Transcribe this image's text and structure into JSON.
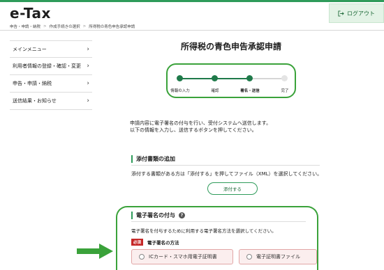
{
  "header": {
    "logo": "e-Tax",
    "logout_label": "ログアウト"
  },
  "breadcrumb": [
    "申告・申請・納税",
    "作成手続きの選択",
    "所得税の青色申告承認申請"
  ],
  "sidebar": {
    "items": [
      {
        "label": "メインメニュー"
      },
      {
        "label": "利用者情報の登録・確認・変更"
      },
      {
        "label": "申告・申請・納税"
      },
      {
        "label": "送信結果・お知らせ"
      }
    ]
  },
  "main": {
    "title": "所得税の青色申告承認申請",
    "steps": [
      {
        "label": "情報の入力",
        "state": "done"
      },
      {
        "label": "確認",
        "state": "done"
      },
      {
        "label": "署名・送信",
        "state": "current"
      },
      {
        "label": "完了",
        "state": "todo"
      }
    ],
    "intro_line1": "申請内容に電子署名の付与を行い、受付システムへ送信します。",
    "intro_line2": "以下の情報を入力し、送信するボタンを押してください。",
    "attach": {
      "title": "添付書類の追加",
      "description": "添付する書類がある方は「添付する」を押してファイル（XML）を選択してください。",
      "button_label": "添付する"
    },
    "signature": {
      "title": "電子署名の付与",
      "help_icon": "?",
      "description": "電子署名を付与するために利用する電子署名方法を選択してください。",
      "required_badge": "必須",
      "method_label": "電子署名の方法",
      "options": [
        {
          "label": "ICカード・スマホ用電子証明書"
        },
        {
          "label": "電子証明書ファイル"
        }
      ]
    }
  },
  "colors": {
    "brand_green": "#2e9b5a",
    "annotation_green": "#3aa23a",
    "required_red": "#c62828"
  }
}
